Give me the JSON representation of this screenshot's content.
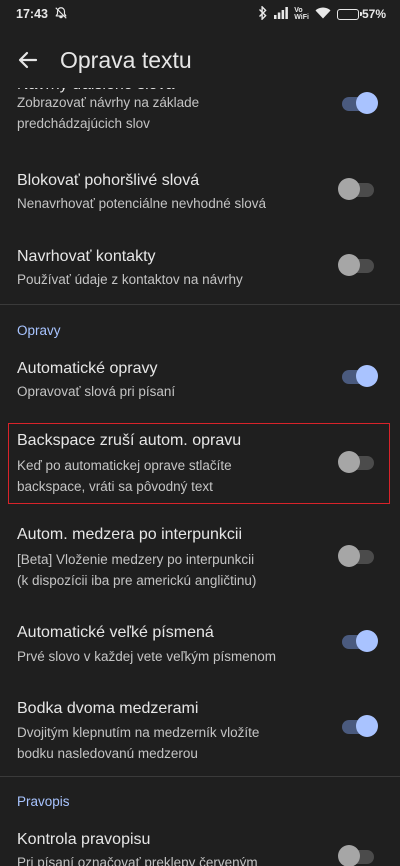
{
  "status_bar": {
    "time": "17:43",
    "icons": [
      "mute-bell-icon",
      "bluetooth-icon",
      "signal-icon",
      "vowifi-icon",
      "wifi-icon",
      "battery-icon"
    ],
    "vowifi_top": "Vo",
    "vowifi_bottom": "WiFi",
    "battery_percent": "57%",
    "battery_level": 0.57
  },
  "app_bar": {
    "back_icon": "arrow-back-icon",
    "title": "Oprava textu"
  },
  "colors": {
    "background": "#1f1f1f",
    "accent": "#a8c4ff",
    "toggle_on_knob": "#a9c3ff",
    "toggle_on_track": "#4a5a7e",
    "toggle_off_knob": "#a6a6a6",
    "highlight_border": "#d8232a"
  },
  "settings": {
    "next_word": {
      "title": "Návrhy ďalšieho slova",
      "subtitle_1": "Zobrazovať návrhy na základe",
      "subtitle_2": "predchádzajúcich slov",
      "enabled": true
    },
    "block_offensive": {
      "title": "Blokovať pohoršlivé slová",
      "subtitle_1": "Nenavrhovať potenciálne nevhodné slová",
      "enabled": false
    },
    "suggest_contacts": {
      "title": "Navrhovať kontakty",
      "subtitle_1": "Používať údaje z kontaktov na návrhy",
      "enabled": false
    },
    "section_corrections": "Opravy",
    "auto_correction": {
      "title": "Automatické opravy",
      "subtitle_1": "Opravovať slová pri písaní",
      "enabled": true
    },
    "backspace_undo": {
      "title": "Backspace zruší autom. opravu",
      "subtitle_1": "Keď po automatickej oprave stlačíte",
      "subtitle_2": "backspace, vráti sa pôvodný text",
      "enabled": false
    },
    "auto_space": {
      "title": "Autom. medzera po interpunkcii",
      "subtitle_1": "[Beta] Vloženie medzery po interpunkcii",
      "subtitle_2": "(k dispozícii iba pre americkú angličtinu)",
      "enabled": false
    },
    "auto_caps": {
      "title": "Automatické veľké písmená",
      "subtitle_1": "Prvé slovo v každej vete veľkým písmenom",
      "enabled": true
    },
    "double_space": {
      "title": "Bodka dvoma medzerami",
      "subtitle_1": "Dvojitým klepnutím na medzerník vložíte",
      "subtitle_2": "bodku nasledovanú medzerou",
      "enabled": true
    },
    "section_spelling": "Pravopis",
    "spell_check": {
      "title": "Kontrola pravopisu",
      "subtitle_1": "Pri písaní označovať preklepy červeným",
      "enabled": false
    }
  }
}
